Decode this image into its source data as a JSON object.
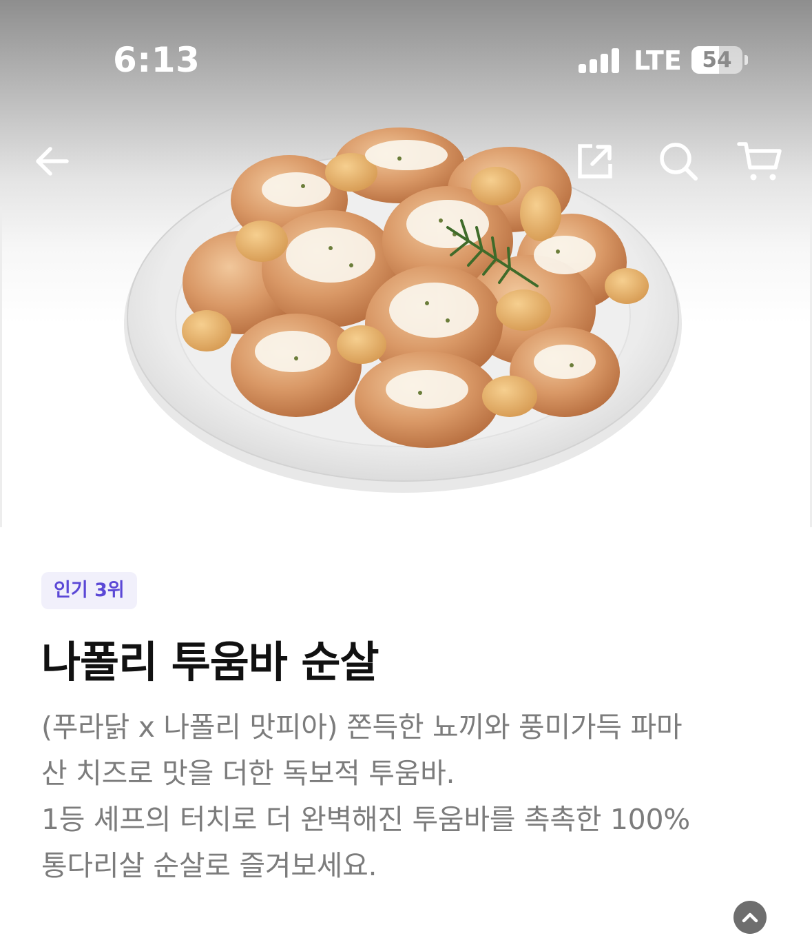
{
  "status_bar": {
    "time": "6:13",
    "network": "LTE",
    "battery_level": "54",
    "battery_fraction": 0.54
  },
  "nav": {
    "icons": [
      "back-arrow-icon",
      "share-icon",
      "search-icon",
      "cart-icon"
    ]
  },
  "product": {
    "badge": "인기 3위",
    "title": "나폴리 투움바 순살",
    "description_lines": [
      "(푸라닭 x 나폴리 맛피아) 쫀득한 뇨끼와 풍미가득 파마",
      "산 치즈로 맛을 더한 독보적 투움바.",
      "1등 셰프의 터치로 더 완벽해진 투움바를 촉촉한 100%",
      "통다리살 순살로 즐겨보세요."
    ]
  },
  "colors": {
    "badge_text": "#5b48d6",
    "badge_bg": "#f1f0fb",
    "title": "#111111",
    "description": "#7c7c7c",
    "scroll_button": "#6e6e6e"
  }
}
